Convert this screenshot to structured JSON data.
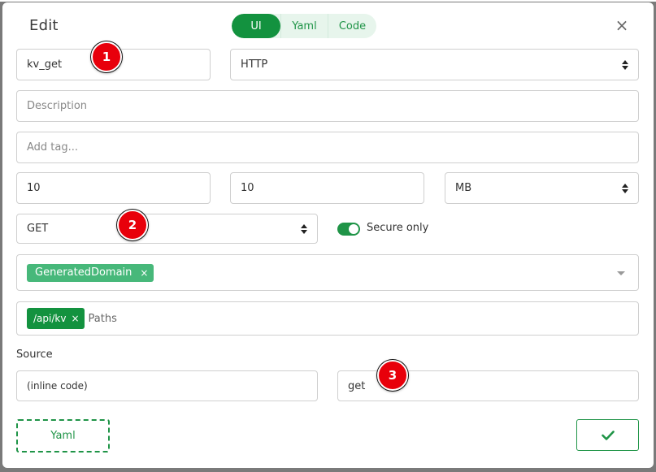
{
  "modal": {
    "title": "Edit",
    "view_tabs": [
      "UI",
      "Yaml",
      "Code"
    ],
    "active_view": "UI"
  },
  "form": {
    "name": "kv_get",
    "type": "HTTP",
    "description_placeholder": "Description",
    "tag_placeholder": "Add tag...",
    "size_a": "10",
    "size_b": "10",
    "size_unit": "MB",
    "method": "GET",
    "secure_only_label": "Secure only",
    "secure_only": true,
    "domain_chip": "GeneratedDomain",
    "path_chip": "/api/kv",
    "paths_placeholder": "Paths",
    "source_label": "Source",
    "source_kind": "(inline code)",
    "source_value": "get"
  },
  "footer": {
    "yaml_button": "Yaml"
  },
  "badges": [
    "1",
    "2",
    "3"
  ],
  "icons": {
    "close": "close-icon",
    "confirm": "check-icon"
  },
  "colors": {
    "accent": "#1f9447",
    "badge": "#e8000b",
    "domain_chip": "#47b87a"
  }
}
